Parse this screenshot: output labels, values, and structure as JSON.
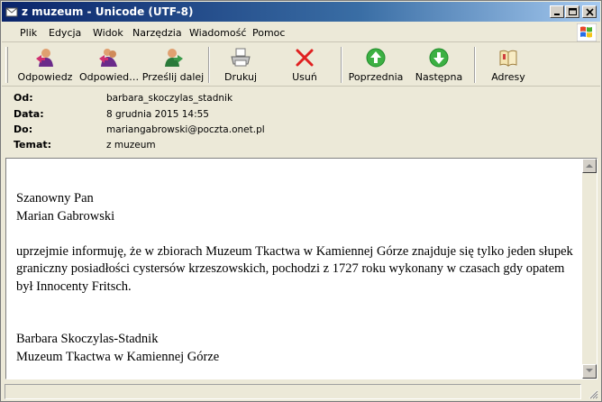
{
  "window": {
    "title": "z muzeum - Unicode (UTF-8)"
  },
  "menu": {
    "items": [
      "Plik",
      "Edycja",
      "Widok",
      "Narzędzia",
      "Wiadomość",
      "Pomoc"
    ]
  },
  "toolbar": {
    "reply": "Odpowiedz",
    "reply_all": "Odpowied…",
    "forward": "Prześlij dalej",
    "print": "Drukuj",
    "delete": "Usuń",
    "previous": "Poprzednia",
    "next": "Następna",
    "addresses": "Adresy"
  },
  "headers": {
    "from_label": "Od:",
    "from_value": "barbara_skoczylas_stadnik",
    "date_label": "Data:",
    "date_value": "8 grudnia 2015 14:55",
    "to_label": "Do:",
    "to_value": "mariangabrowski@poczta.onet.pl",
    "subject_label": "Temat:",
    "subject_value": "z muzeum"
  },
  "message": {
    "greeting_line1": "Szanowny Pan",
    "greeting_line2": "Marian Gabrowski",
    "paragraph": "uprzejmie informuję, że w zbiorach Muzeum Tkactwa w Kamiennej Górze znajduje się  tylko jeden słupek graniczny posiadłości cystersów krzeszowskich, pochodzi z 1727 roku wykonany w czasach gdy opatem był Innocenty Fritsch.",
    "signature_line1": "Barbara Skoczylas-Stadnik",
    "signature_line2": "Muzeum Tkactwa w Kamiennej Górze"
  }
}
